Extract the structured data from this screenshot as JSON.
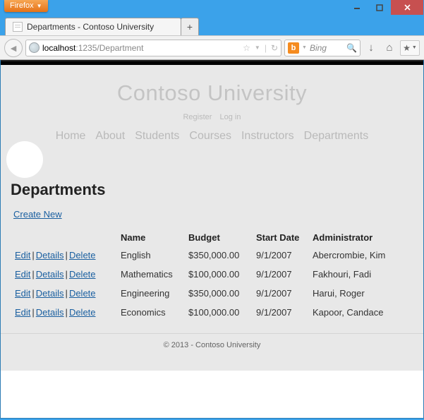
{
  "browser": {
    "app_button": "Firefox",
    "tab_title": "Departments - Contoso University",
    "url_host": "localhost",
    "url_path": ":1235/Department",
    "search_engine": "Bing",
    "newtab": "+"
  },
  "site": {
    "title": "Contoso University",
    "auth": {
      "register": "Register",
      "login": "Log in"
    },
    "nav": [
      "Home",
      "About",
      "Students",
      "Courses",
      "Instructors",
      "Departments"
    ]
  },
  "page": {
    "heading": "Departments",
    "create_link": "Create New",
    "columns": [
      "Name",
      "Budget",
      "Start Date",
      "Administrator"
    ],
    "actions": {
      "edit": "Edit",
      "details": "Details",
      "delete": "Delete"
    },
    "rows": [
      {
        "name": "English",
        "budget": "$350,000.00",
        "start": "9/1/2007",
        "admin": "Abercrombie, Kim"
      },
      {
        "name": "Mathematics",
        "budget": "$100,000.00",
        "start": "9/1/2007",
        "admin": "Fakhouri, Fadi"
      },
      {
        "name": "Engineering",
        "budget": "$350,000.00",
        "start": "9/1/2007",
        "admin": "Harui, Roger"
      },
      {
        "name": "Economics",
        "budget": "$100,000.00",
        "start": "9/1/2007",
        "admin": "Kapoor, Candace"
      }
    ]
  },
  "footer": "© 2013 - Contoso University"
}
